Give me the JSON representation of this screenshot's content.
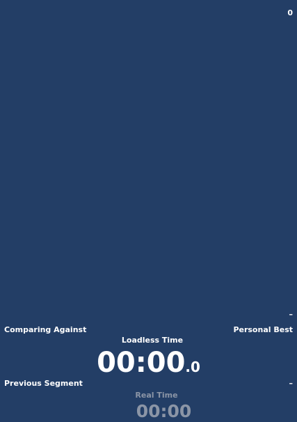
{
  "header": {
    "attempt_count": "0"
  },
  "splits": {
    "final_delta": "–"
  },
  "comparison": {
    "label": "Comparing Against",
    "value": "Personal Best"
  },
  "loadless": {
    "label": "Loadless Time",
    "main": "00:00",
    "fraction": ".0"
  },
  "previous_segment": {
    "label": "Previous Segment",
    "value": "–"
  },
  "real_time": {
    "label": "Real Time",
    "value": "00:00"
  },
  "colors": {
    "background": "#233e66",
    "text": "#ffffff",
    "muted_text": "#8b95a6"
  }
}
